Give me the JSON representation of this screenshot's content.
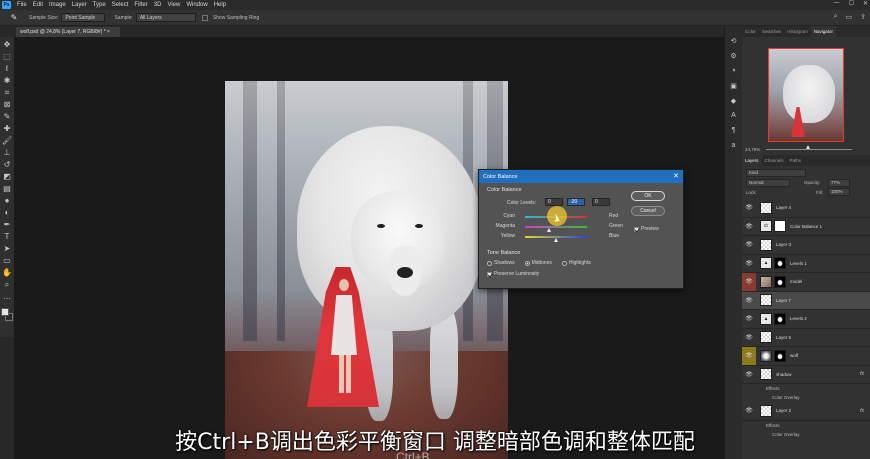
{
  "menubar": {
    "logo": "Ps",
    "items": [
      "File",
      "Edit",
      "Image",
      "Layer",
      "Type",
      "Select",
      "Filter",
      "3D",
      "View",
      "Window",
      "Help"
    ],
    "window_controls": [
      "—",
      "☐",
      "✕"
    ]
  },
  "options": {
    "sample_size_label": "Sample Size:",
    "sample_size_value": "Point Sample",
    "sample_label": "Sample:",
    "sample_value": "All Layers",
    "show_ring_label": "Show Sampling Ring"
  },
  "document_tab": "wolf.psd @ 24,8% (Layer 7, RGB/8#) *  ×",
  "color_balance": {
    "title": "Color Balance",
    "section_title": "Color Balance",
    "levels_label": "Color Levels:",
    "levels": [
      "0",
      "-20",
      "0"
    ],
    "sliders": [
      {
        "left": "Cyan",
        "right": "Red",
        "value": 0
      },
      {
        "left": "Magenta",
        "right": "Green",
        "value": -20
      },
      {
        "left": "Yellow",
        "right": "Blue",
        "value": 0
      }
    ],
    "tone_title": "Tone Balance",
    "tones": [
      "Shadows",
      "Midtones",
      "Highlights"
    ],
    "selected_tone": "Midtones",
    "preserve_label": "Preserve Luminosity",
    "ok_label": "OK",
    "cancel_label": "Cancel",
    "preview_label": "Preview"
  },
  "panels": {
    "top_tabs": [
      "Color",
      "Swatches",
      "Histogram",
      "Navigator"
    ],
    "active_top_tab": "Navigator",
    "zoom": "24,78%",
    "layer_tabs": [
      "Layers",
      "Channels",
      "Paths"
    ],
    "kind_label": "Kind",
    "blend_mode": "Normal",
    "opacity_label": "Opacity:",
    "opacity": "77%",
    "lock_label": "Lock:",
    "fill_label": "Fill:",
    "fill": "100%"
  },
  "layers": [
    {
      "name": "Layer 4",
      "type": "pixel",
      "eye": "👁"
    },
    {
      "name": "Color Balance 1",
      "type": "adjust",
      "eye": "👁"
    },
    {
      "name": "Layer 3",
      "type": "pixel",
      "eye": "👁"
    },
    {
      "name": "Levels 1",
      "type": "levels",
      "eye": "👁"
    },
    {
      "name": "model",
      "type": "photo",
      "eye": "👁"
    },
    {
      "name": "Layer 7",
      "type": "pixel",
      "eye": "👁",
      "selected": true
    },
    {
      "name": "Levels 2",
      "type": "levels",
      "eye": "👁"
    },
    {
      "name": "Layer 5",
      "type": "pixel",
      "eye": "👁"
    },
    {
      "name": "wolf",
      "type": "wolf",
      "eye": "👁"
    },
    {
      "name": "shadow",
      "type": "pixel",
      "eye": "👁",
      "fx": "fx"
    },
    {
      "name": "Effects",
      "type": "sub"
    },
    {
      "name": "Color Overlay",
      "type": "sub"
    },
    {
      "name": "Layer 2",
      "type": "pixel",
      "eye": "👁",
      "fx": "fx"
    },
    {
      "name": "Effects",
      "type": "sub"
    },
    {
      "name": "Color Overlay",
      "type": "sub"
    }
  ],
  "subtitle": "按Ctrl+B调出色彩平衡窗口 调整暗部色调和整体匹配",
  "subtitle_echo": "Ctrl+B",
  "colors": {
    "accent": "#1f6fbe",
    "cloak_red": "#d6333a",
    "navigator_frame": "#e03b2e"
  },
  "icons": {
    "toolbar": [
      "move-icon",
      "marquee-icon",
      "lasso-icon",
      "quick-select-icon",
      "crop-icon",
      "frame-icon",
      "eyedropper-icon",
      "healing-icon",
      "brush-icon",
      "stamp-icon",
      "history-brush-icon",
      "eraser-icon",
      "gradient-icon",
      "blur-icon",
      "dodge-icon",
      "pen-icon",
      "type-icon",
      "path-select-icon",
      "shape-icon",
      "hand-icon",
      "zoom-icon",
      "more-icon"
    ],
    "iconcol": [
      "history-icon",
      "properties-icon",
      "adjustments-icon",
      "libraries-icon",
      "3d-icon",
      "character-icon",
      "paragraph-icon",
      "glyphs-icon"
    ]
  }
}
